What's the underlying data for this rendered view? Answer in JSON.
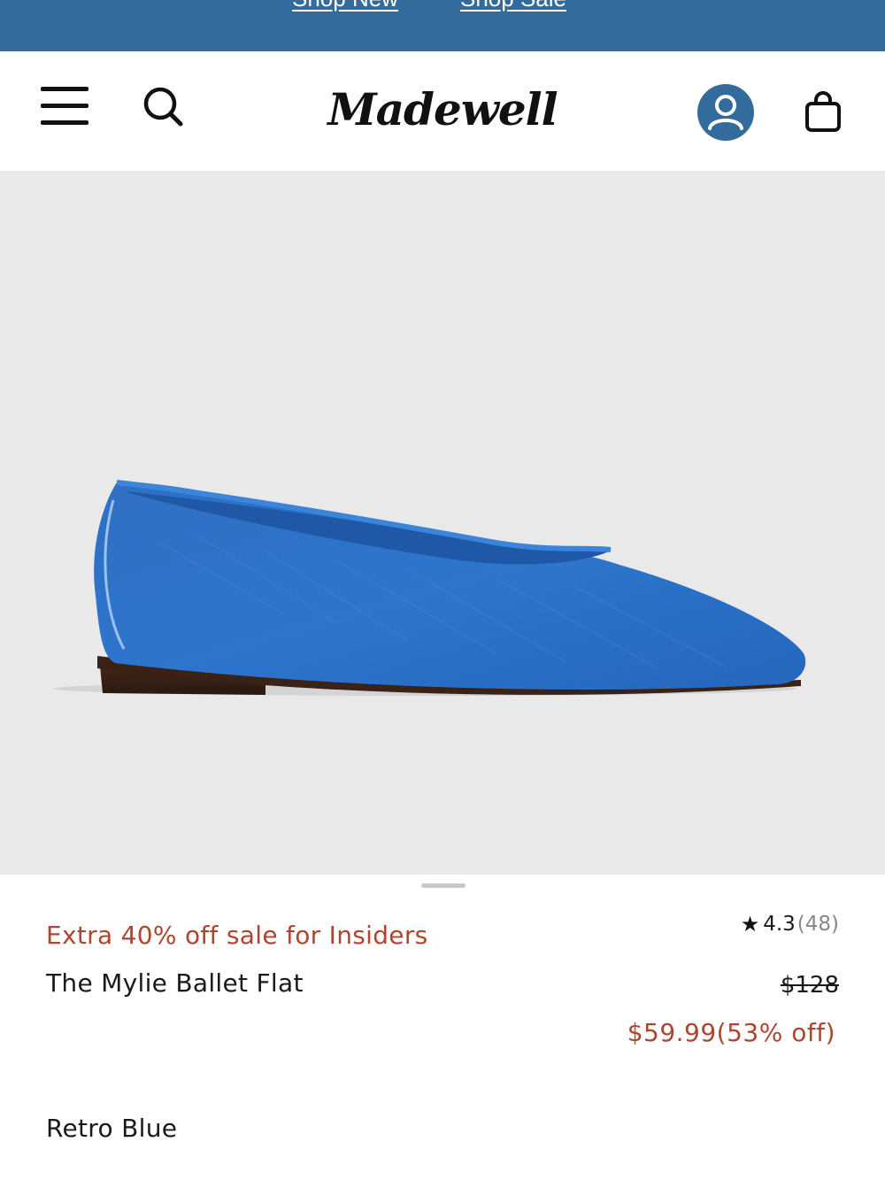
{
  "promo_bar": {
    "link_1": "Shop New",
    "link_2": "Shop Sale"
  },
  "header": {
    "logo_text": "Madewell",
    "icons": {
      "menu": "menu-icon",
      "search": "search-icon",
      "account": "account-icon",
      "bag": "bag-icon"
    }
  },
  "product": {
    "image_subject": "blue mesh ballet flat",
    "promo_text": "Extra 40% off sale for Insiders",
    "name": "The Mylie Ballet Flat",
    "rating_value": "4.3",
    "rating_count": "(48)",
    "original_price": "$128",
    "sale_price": "$59.99(53% off)",
    "color_name": "Retro Blue"
  },
  "colors": {
    "brand_blue": "#336c9c",
    "sale_red": "#b0452f",
    "shoe_blue": "#2e72c8"
  }
}
